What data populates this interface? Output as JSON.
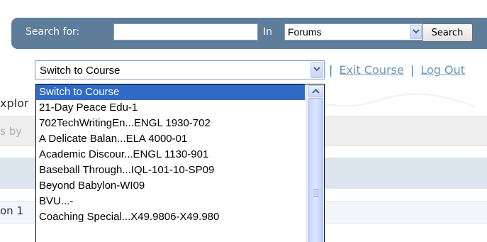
{
  "search": {
    "label": "Search for:",
    "query": "",
    "in_label": "In",
    "scope": "Forums",
    "button": "Search"
  },
  "nav": {
    "separator": "|",
    "exit_course": "Exit Course",
    "log_out": "Log Out"
  },
  "background": {
    "fragment_explore": "xplor",
    "fragment_by": "s by",
    "fragment_row": "on 1"
  },
  "course_switcher": {
    "value": "Switch to Course",
    "options": [
      "Switch to Course",
      "21-Day Peace Edu-1",
      "702TechWritingEn...ENGL 1930-702",
      "A Delicate Balan...ELA 4000-01",
      "Academic Discour...ENGL 1130-901",
      "Baseball Through...IQL-101-10-SP09",
      "Beyond Babylon-WI09",
      "BVU...-",
      "Coaching Special...X49.9806-X49.980"
    ],
    "selected_index": 0
  },
  "icons": {
    "dropdown": "chevron-down-icon",
    "scroll_up": "chevron-up-icon"
  },
  "colors": {
    "search_bar": "#5d7d9b",
    "selection": "#316ac5",
    "link": "#6b94b8"
  }
}
